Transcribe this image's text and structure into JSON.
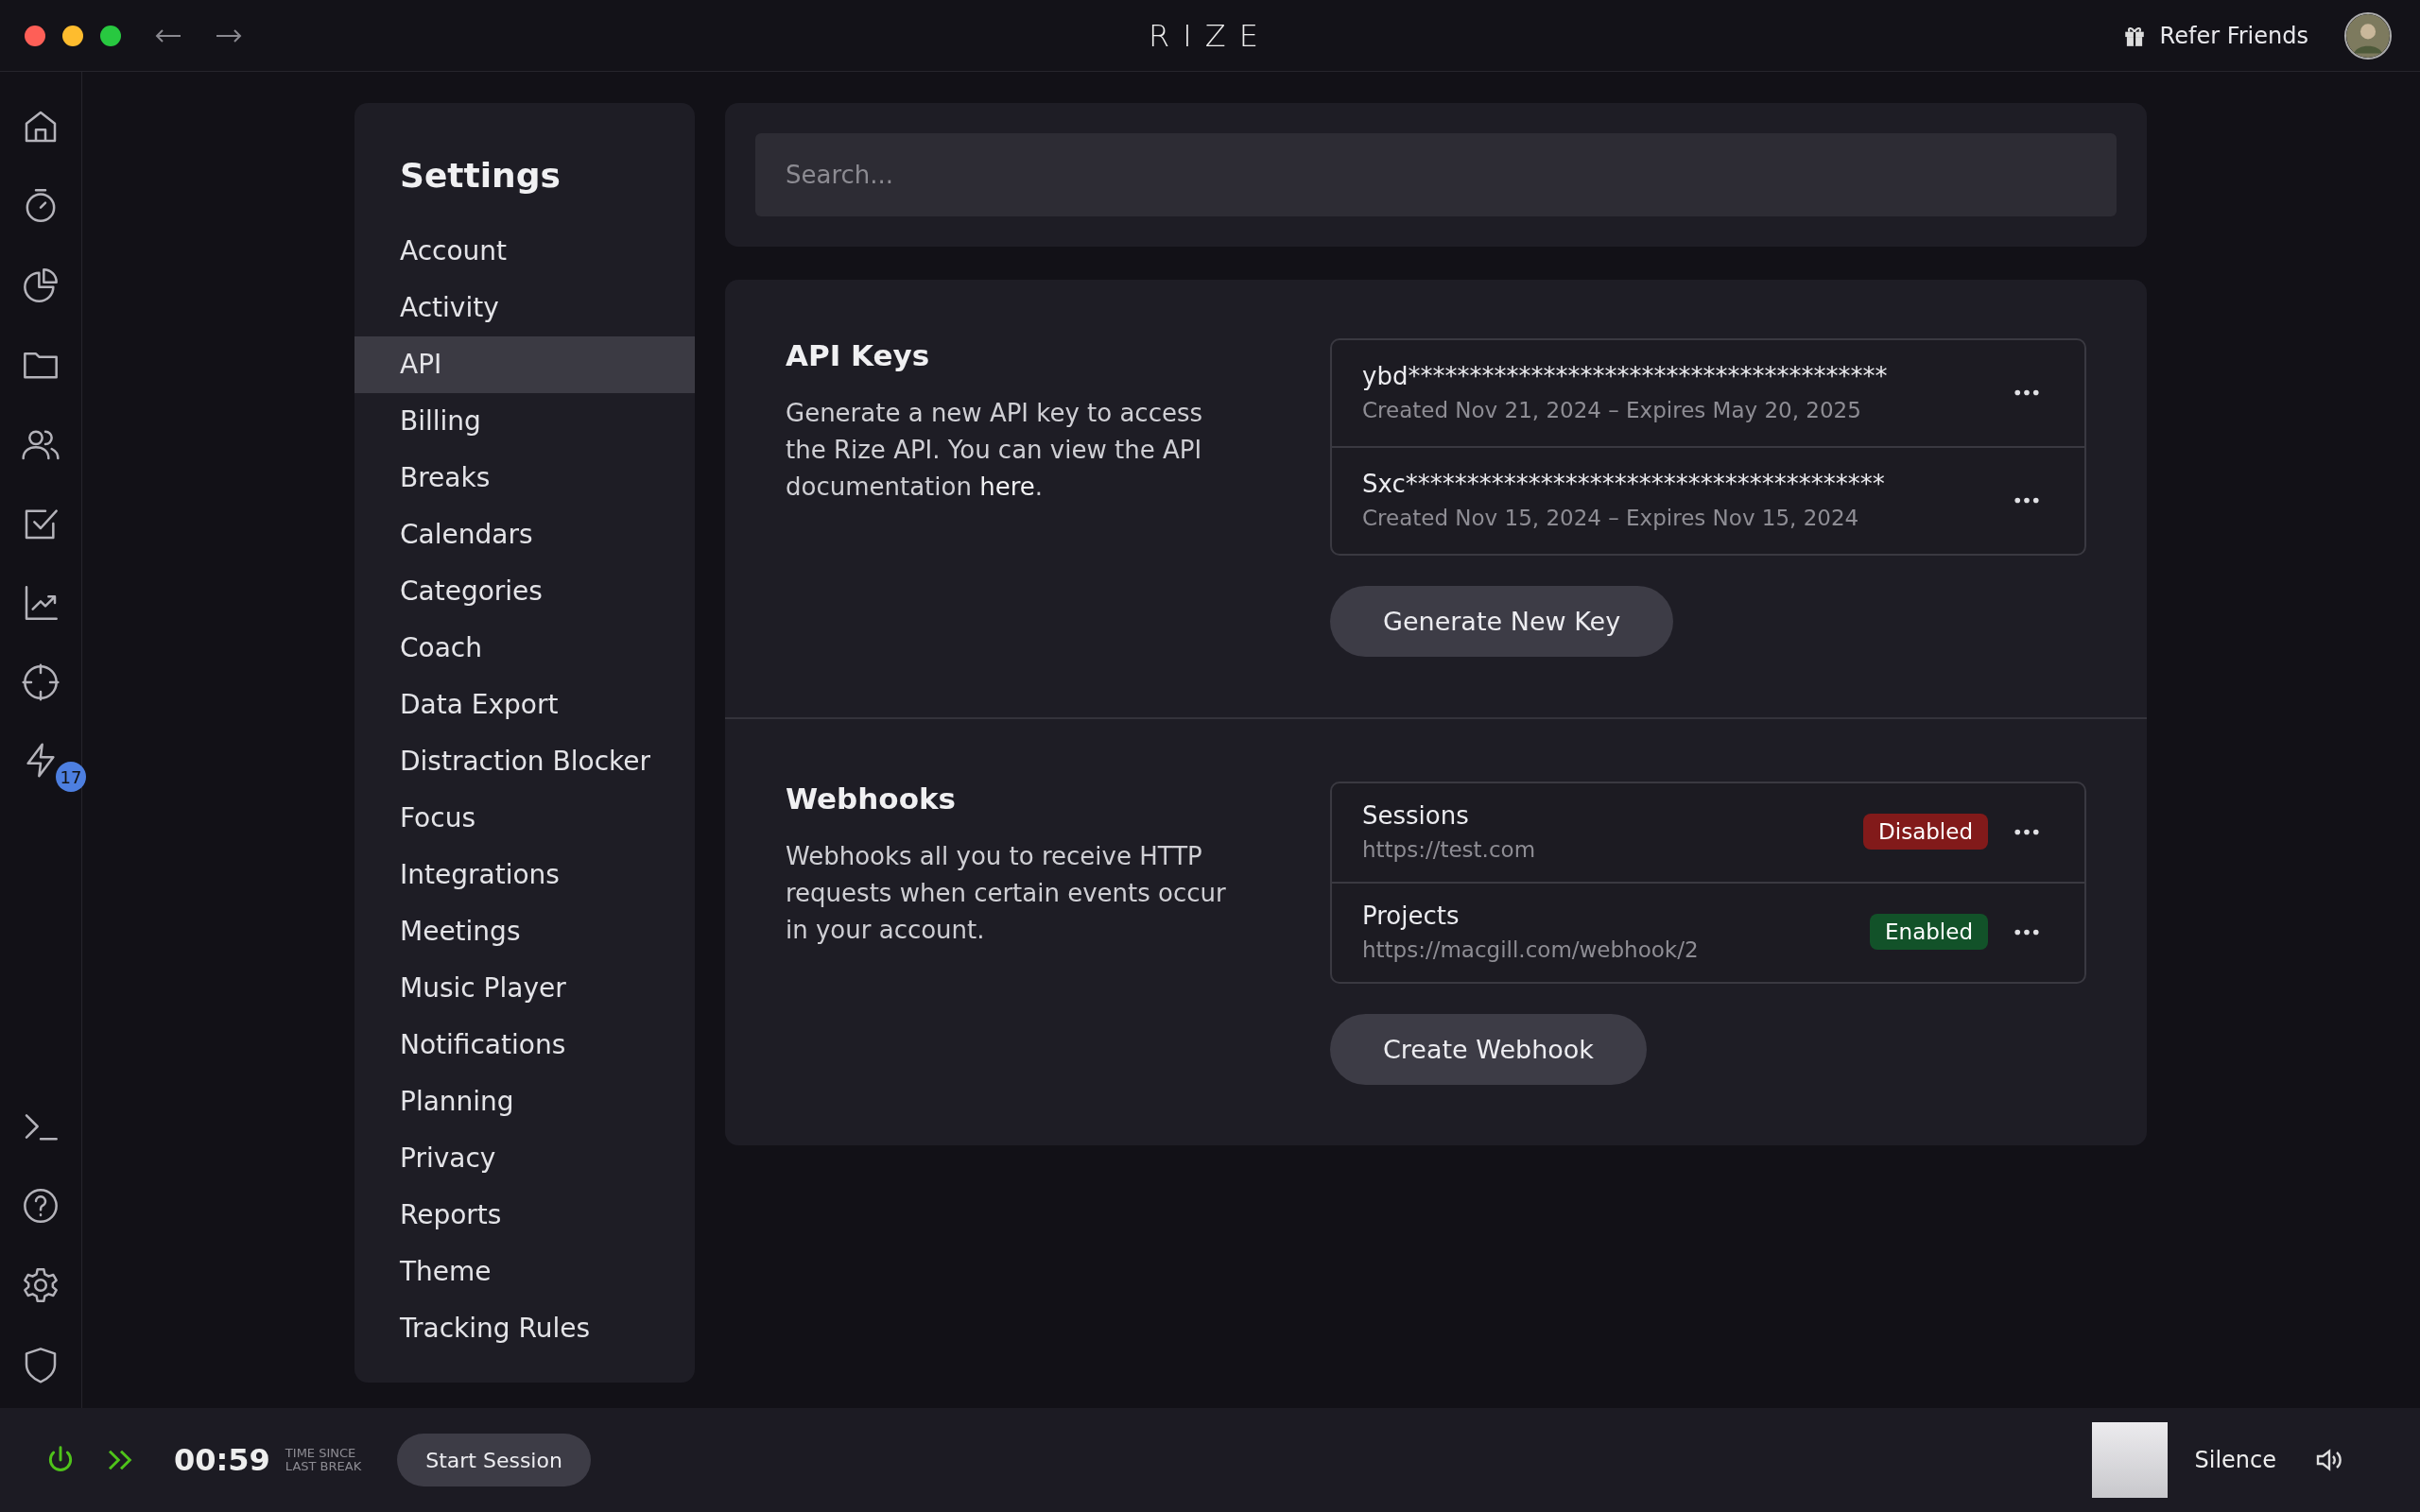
{
  "window": {
    "title": "RIZE",
    "refer": "Refer Friends"
  },
  "rail": {
    "badge": "17"
  },
  "settings": {
    "title": "Settings",
    "items": [
      {
        "label": "Account",
        "selected": false
      },
      {
        "label": "Activity",
        "selected": false
      },
      {
        "label": "API",
        "selected": true
      },
      {
        "label": "Billing",
        "selected": false
      },
      {
        "label": "Breaks",
        "selected": false
      },
      {
        "label": "Calendars",
        "selected": false
      },
      {
        "label": "Categories",
        "selected": false
      },
      {
        "label": "Coach",
        "selected": false
      },
      {
        "label": "Data Export",
        "selected": false
      },
      {
        "label": "Distraction Blocker",
        "selected": false
      },
      {
        "label": "Focus",
        "selected": false
      },
      {
        "label": "Integrations",
        "selected": false
      },
      {
        "label": "Meetings",
        "selected": false
      },
      {
        "label": "Music Player",
        "selected": false
      },
      {
        "label": "Notifications",
        "selected": false
      },
      {
        "label": "Planning",
        "selected": false
      },
      {
        "label": "Privacy",
        "selected": false
      },
      {
        "label": "Reports",
        "selected": false
      },
      {
        "label": "Theme",
        "selected": false
      },
      {
        "label": "Tracking Rules",
        "selected": false
      }
    ]
  },
  "search": {
    "placeholder": "Search..."
  },
  "api_keys": {
    "title": "API Keys",
    "description": "Generate a new API key to access the Rize API. You can view the API documentation ",
    "link": "here",
    "description_end": ".",
    "keys": [
      {
        "key": "ybd***************************************",
        "dates": "Created Nov 21, 2024 – Expires May 20, 2025"
      },
      {
        "key": "Sxc***************************************",
        "dates": "Created Nov 15, 2024 – Expires Nov 15, 2024"
      }
    ],
    "button": "Generate New Key"
  },
  "webhooks": {
    "title": "Webhooks",
    "description": "Webhooks all you to receive HTTP requests when certain events occur in your account.",
    "items": [
      {
        "name": "Sessions",
        "url": "https://test.com",
        "status": "Disabled",
        "enabled": false
      },
      {
        "name": "Projects",
        "url": "https://macgill.com/webhook/2",
        "status": "Enabled",
        "enabled": true
      }
    ],
    "button": "Create Webhook"
  },
  "bottom_bar": {
    "time": "00:59",
    "time_label_1": "TIME SINCE",
    "time_label_2": "LAST BREAK",
    "button": "Start Session",
    "track": "Silence"
  }
}
